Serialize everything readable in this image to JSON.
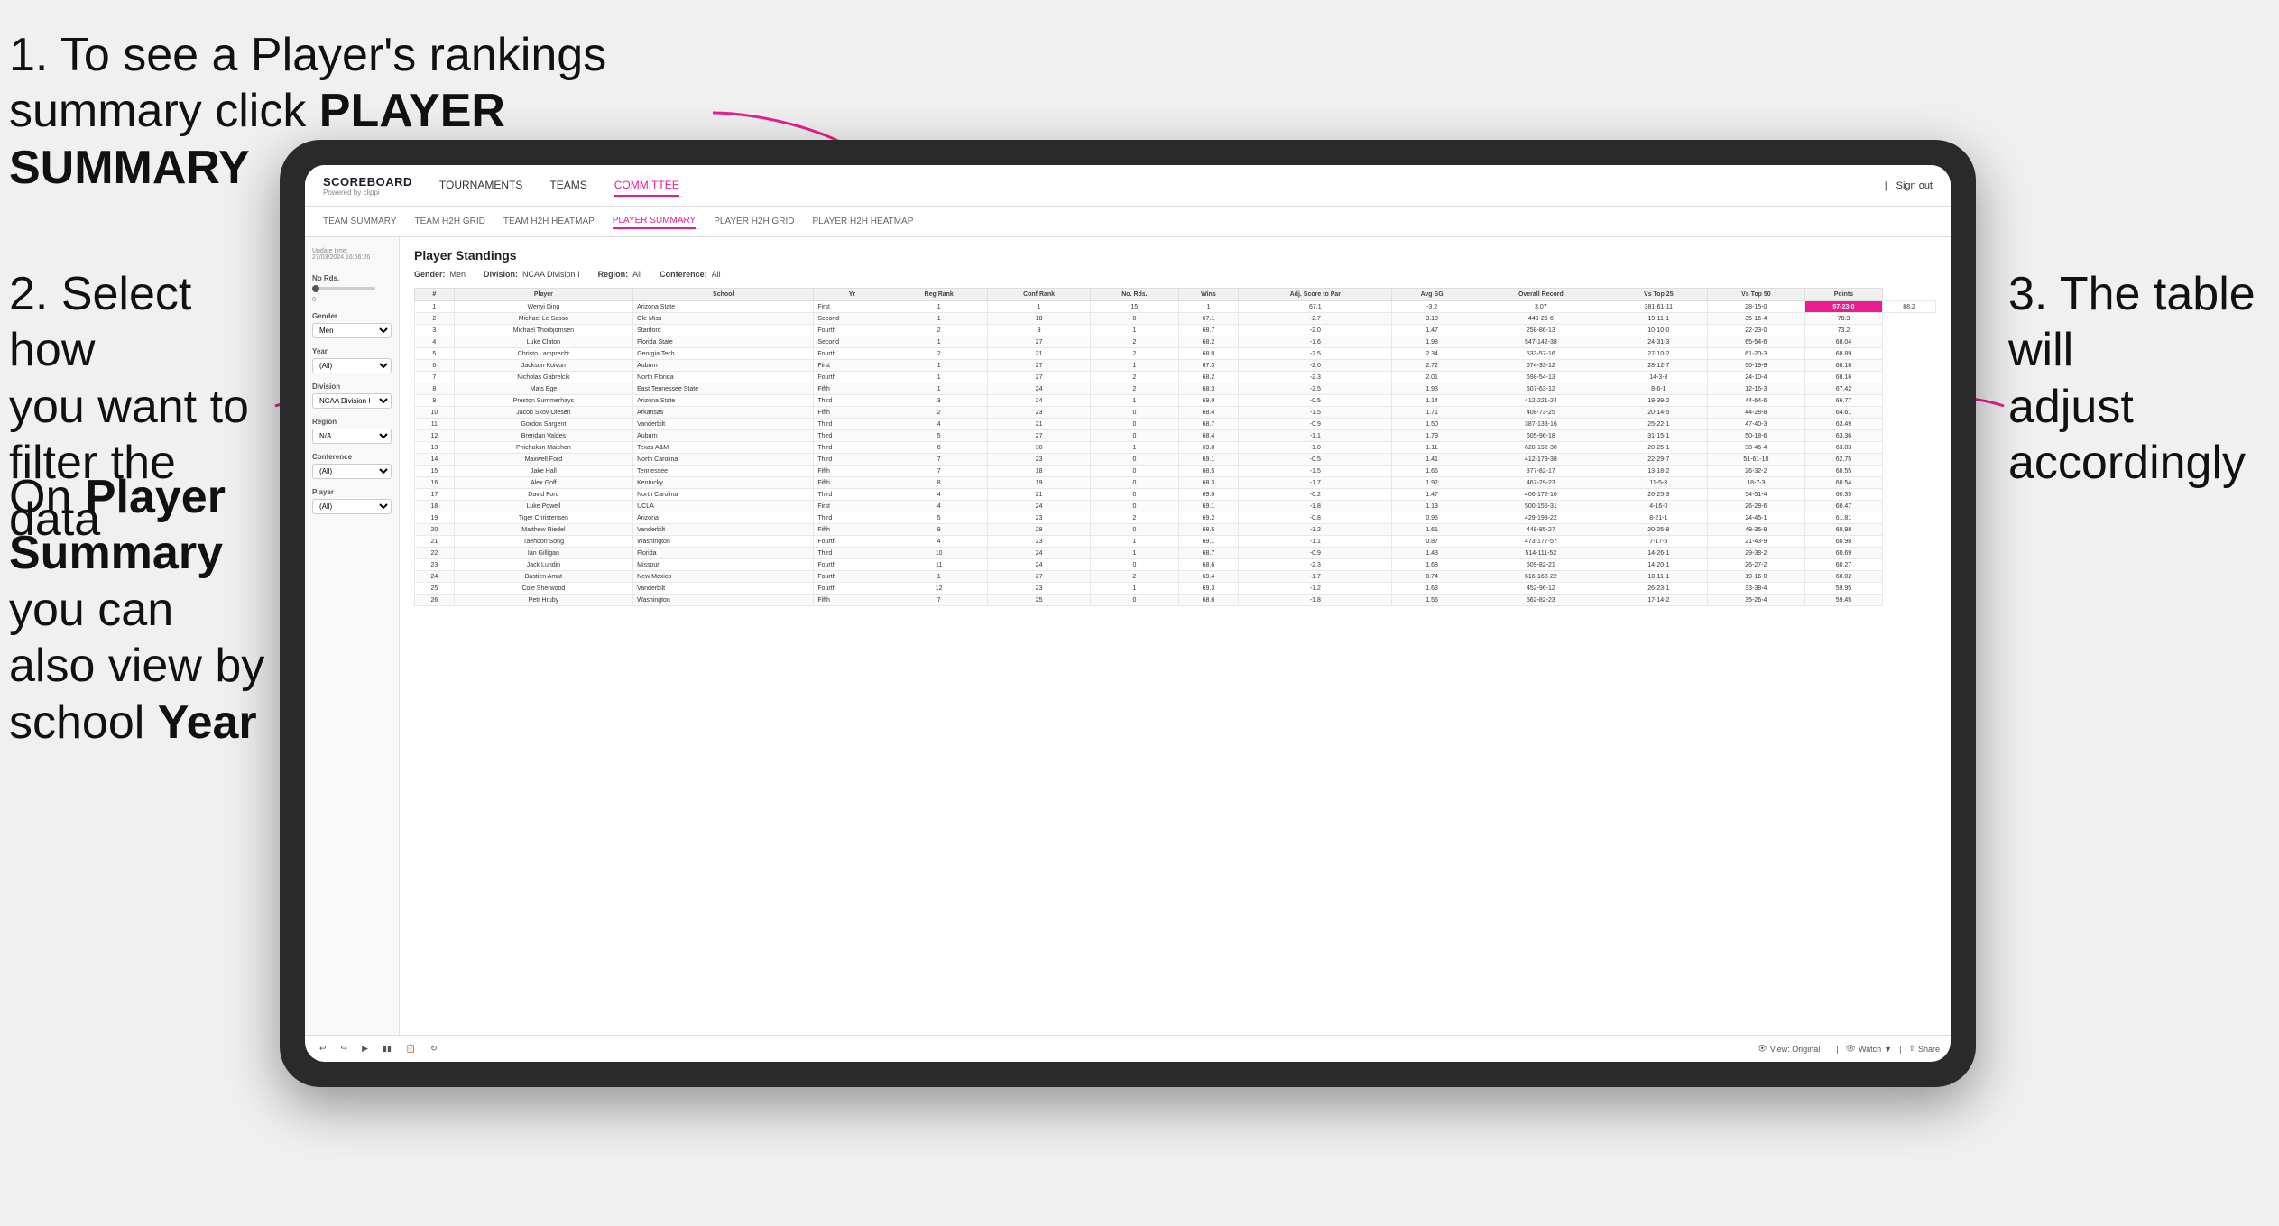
{
  "annotations": {
    "annotation1": "1. To see a Player's rankings summary click ",
    "annotation1_bold": "PLAYER SUMMARY",
    "annotation2_line1": "2. Select how",
    "annotation2_line2": "you want to",
    "annotation2_line3": "filter the data",
    "annotation3_left_pre": "On ",
    "annotation3_left_bold": "Player Summary",
    "annotation3_left_post": " you can also view by school ",
    "annotation3_left_bold2": "Year",
    "annotation3_right_line1": "3. The table will",
    "annotation3_right_line2": "adjust accordingly"
  },
  "nav": {
    "logo": "SCOREBOARD",
    "logo_sub": "Powered by clippi",
    "items": [
      "TOURNAMENTS",
      "TEAMS",
      "COMMITTEE"
    ],
    "sign_out": "Sign out"
  },
  "sub_nav": {
    "items": [
      "TEAM SUMMARY",
      "TEAM H2H GRID",
      "TEAM H2H HEATMAP",
      "PLAYER SUMMARY",
      "PLAYER H2H GRID",
      "PLAYER H2H HEATMAP"
    ]
  },
  "sidebar": {
    "update_time_label": "Update time:",
    "update_time": "27/03/2024 16:56:26",
    "no_rds_label": "No Rds.",
    "gender_label": "Gender",
    "gender_value": "Men",
    "year_label": "Year",
    "year_value": "(All)",
    "division_label": "Division",
    "division_value": "NCAA Division I",
    "region_label": "Region",
    "region_value": "N/A",
    "conference_label": "Conference",
    "conference_value": "(All)",
    "player_label": "Player",
    "player_value": "(All)"
  },
  "table": {
    "title": "Player Standings",
    "filters": {
      "gender_label": "Gender:",
      "gender_value": "Men",
      "division_label": "Division:",
      "division_value": "NCAA Division I",
      "region_label": "Region:",
      "region_value": "All",
      "conference_label": "Conference:",
      "conference_value": "All"
    },
    "headers": [
      "#",
      "Player",
      "School",
      "Yr",
      "Reg Rank",
      "Conf Rank",
      "No. Rds.",
      "Wins",
      "Adj. Score to Par",
      "Avg SG",
      "Overall Record",
      "Vs Top 25",
      "Vs Top 50",
      "Points"
    ],
    "rows": [
      [
        "1",
        "Wenyi Ding",
        "Arizona State",
        "First",
        "1",
        "1",
        "15",
        "1",
        "67.1",
        "-3.2",
        "3.07",
        "381-61-11",
        "28-15-0",
        "57-23-0",
        "88.2"
      ],
      [
        "2",
        "Michael Le Sasso",
        "Ole Miss",
        "Second",
        "1",
        "18",
        "0",
        "67.1",
        "-2.7",
        "3.10",
        "440-26-6",
        "19-11-1",
        "35-16-4",
        "78.3"
      ],
      [
        "3",
        "Michael Thorbjornsen",
        "Stanford",
        "Fourth",
        "2",
        "9",
        "1",
        "68.7",
        "-2.0",
        "1.47",
        "258-86-13",
        "10-10-0",
        "22-23-0",
        "73.2"
      ],
      [
        "4",
        "Luke Claton",
        "Florida State",
        "Second",
        "1",
        "27",
        "2",
        "68.2",
        "-1.6",
        "1.98",
        "547-142-38",
        "24-31-3",
        "65-54-6",
        "68.04"
      ],
      [
        "5",
        "Christo Lamprecht",
        "Georgia Tech",
        "Fourth",
        "2",
        "21",
        "2",
        "68.0",
        "-2.5",
        "2.34",
        "533-57-16",
        "27-10-2",
        "61-20-3",
        "68.89"
      ],
      [
        "6",
        "Jackson Koivun",
        "Auburn",
        "First",
        "1",
        "27",
        "1",
        "67.3",
        "-2.0",
        "2.72",
        "674-33-12",
        "28-12-7",
        "50-19-9",
        "68.18"
      ],
      [
        "7",
        "Nicholas Gabrelcik",
        "North Florida",
        "Fourth",
        "1",
        "27",
        "2",
        "68.2",
        "-2.3",
        "2.01",
        "698-54-13",
        "14-3-3",
        "24-10-4",
        "68.16"
      ],
      [
        "8",
        "Mats Ege",
        "East Tennessee State",
        "Fifth",
        "1",
        "24",
        "2",
        "68.3",
        "-2.5",
        "1.93",
        "607-63-12",
        "8-6-1",
        "12-16-3",
        "67.42"
      ],
      [
        "9",
        "Preston Summerhays",
        "Arizona State",
        "Third",
        "3",
        "24",
        "1",
        "69.0",
        "-0.5",
        "1.14",
        "412-221-24",
        "19-39-2",
        "44-64-6",
        "66.77"
      ],
      [
        "10",
        "Jacob Skov Olesen",
        "Arkansas",
        "Fifth",
        "2",
        "23",
        "0",
        "68.4",
        "-1.5",
        "1.71",
        "408-73-25",
        "20-14-5",
        "44-28-8",
        "64.61"
      ],
      [
        "11",
        "Gordon Sargent",
        "Vanderbilt",
        "Third",
        "4",
        "21",
        "0",
        "68.7",
        "-0.9",
        "1.50",
        "387-133-16",
        "25-22-1",
        "47-40-3",
        "63.49"
      ],
      [
        "12",
        "Brendan Valdes",
        "Auburn",
        "Third",
        "5",
        "27",
        "0",
        "68.4",
        "-1.1",
        "1.79",
        "605-96-18",
        "31-15-1",
        "50-18-6",
        "63.36"
      ],
      [
        "13",
        "Phichaksn Maichon",
        "Texas A&M",
        "Third",
        "6",
        "30",
        "1",
        "69.0",
        "-1.0",
        "1.11",
        "628-192-30",
        "20-25-1",
        "38-46-4",
        "63.03"
      ],
      [
        "14",
        "Maxwell Ford",
        "North Carolina",
        "Third",
        "7",
        "23",
        "0",
        "69.1",
        "-0.5",
        "1.41",
        "412-179-38",
        "22-29-7",
        "51-61-10",
        "62.75"
      ],
      [
        "15",
        "Jake Hall",
        "Tennessee",
        "Fifth",
        "7",
        "18",
        "0",
        "68.5",
        "-1.5",
        "1.66",
        "377-82-17",
        "13-18-2",
        "26-32-2",
        "60.55"
      ],
      [
        "16",
        "Alex Goff",
        "Kentucky",
        "Fifth",
        "8",
        "19",
        "0",
        "68.3",
        "-1.7",
        "1.92",
        "467-29-23",
        "11-5-3",
        "18-7-3",
        "60.54"
      ],
      [
        "17",
        "David Ford",
        "North Carolina",
        "Third",
        "4",
        "21",
        "0",
        "69.0",
        "-0.2",
        "1.47",
        "406-172-16",
        "26-25-3",
        "54-51-4",
        "60.35"
      ],
      [
        "18",
        "Luke Powell",
        "UCLA",
        "First",
        "4",
        "24",
        "0",
        "69.1",
        "-1.8",
        "1.13",
        "500-155-31",
        "4-16-0",
        "26-28-6",
        "60.47"
      ],
      [
        "19",
        "Tiger Christensen",
        "Arizona",
        "Third",
        "5",
        "23",
        "2",
        "69.2",
        "-0.8",
        "0.96",
        "429-198-22",
        "8-21-1",
        "24-45-1",
        "61.81"
      ],
      [
        "20",
        "Matthew Riedel",
        "Vanderbilt",
        "Fifth",
        "9",
        "28",
        "0",
        "68.5",
        "-1.2",
        "1.61",
        "448-85-27",
        "20-25-8",
        "49-35-9",
        "60.98"
      ],
      [
        "21",
        "Taehoon Song",
        "Washington",
        "Fourth",
        "4",
        "23",
        "1",
        "69.1",
        "-1.1",
        "0.87",
        "473-177-57",
        "7-17-5",
        "21-43-9",
        "60.98"
      ],
      [
        "22",
        "Ian Gilligan",
        "Florida",
        "Third",
        "10",
        "24",
        "1",
        "68.7",
        "-0.9",
        "1.43",
        "514-111-52",
        "14-26-1",
        "29-38-2",
        "60.69"
      ],
      [
        "23",
        "Jack Lundin",
        "Missouri",
        "Fourth",
        "11",
        "24",
        "0",
        "68.6",
        "-2.3",
        "1.68",
        "509-82-21",
        "14-20-1",
        "26-27-2",
        "60.27"
      ],
      [
        "24",
        "Bastien Amat",
        "New Mexico",
        "Fourth",
        "1",
        "27",
        "2",
        "69.4",
        "-1.7",
        "0.74",
        "616-168-22",
        "10-11-1",
        "19-16-0",
        "60.02"
      ],
      [
        "25",
        "Cole Sherwood",
        "Vanderbilt",
        "Fourth",
        "12",
        "23",
        "1",
        "69.3",
        "-1.2",
        "1.63",
        "452-96-12",
        "26-23-1",
        "33-38-4",
        "59.95"
      ],
      [
        "26",
        "Petr Hruby",
        "Washington",
        "Fifth",
        "7",
        "25",
        "0",
        "68.6",
        "-1.8",
        "1.56",
        "562-82-23",
        "17-14-2",
        "35-26-4",
        "59.45"
      ]
    ]
  },
  "toolbar": {
    "view_label": "View: Original",
    "watch_label": "Watch",
    "share_label": "Share"
  }
}
